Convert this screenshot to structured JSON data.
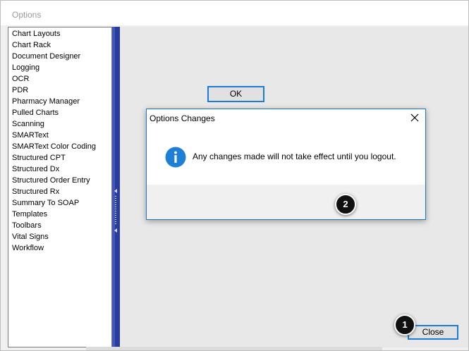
{
  "window": {
    "title": "Options"
  },
  "sidebar": {
    "items": [
      {
        "label": "Chart Layouts"
      },
      {
        "label": "Chart Rack"
      },
      {
        "label": "Document Designer"
      },
      {
        "label": "Logging"
      },
      {
        "label": "OCR"
      },
      {
        "label": "PDR"
      },
      {
        "label": "Pharmacy Manager"
      },
      {
        "label": "Pulled Charts"
      },
      {
        "label": "Scanning"
      },
      {
        "label": "SMARText"
      },
      {
        "label": "SMARText Color Coding"
      },
      {
        "label": "Structured CPT"
      },
      {
        "label": "Structured Dx"
      },
      {
        "label": "Structured Order Entry"
      },
      {
        "label": "Structured Rx"
      },
      {
        "label": "Summary To SOAP"
      },
      {
        "label": "Templates"
      },
      {
        "label": "Toolbars"
      },
      {
        "label": "Vital Signs"
      },
      {
        "label": "Workflow"
      }
    ]
  },
  "footer": {
    "close_label": "Close"
  },
  "dialog": {
    "title": "Options Changes",
    "message": "Any changes made will not take effect until you logout.",
    "ok_label": "OK",
    "icon": "info-icon"
  },
  "callouts": {
    "first": "1",
    "second": "2"
  },
  "colors": {
    "accent": "#1c7bd4",
    "splitter": "#2a3c9a",
    "info_icon": "#1e7fd6",
    "callout": "#111111"
  }
}
